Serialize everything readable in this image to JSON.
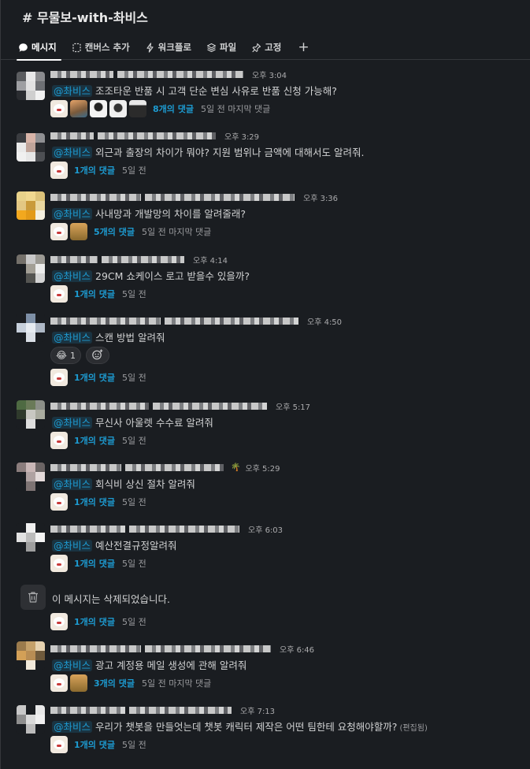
{
  "channel": {
    "title": "# 무물보-with-촤비스"
  },
  "tabs": [
    {
      "label": "메시지",
      "icon": "message-icon",
      "active": true
    },
    {
      "label": "캔버스 추가",
      "icon": "canvas-icon",
      "active": false
    },
    {
      "label": "워크플로",
      "icon": "workflow-icon",
      "active": false
    },
    {
      "label": "파일",
      "icon": "files-icon",
      "active": false
    },
    {
      "label": "고정",
      "icon": "pin-icon",
      "active": false
    }
  ],
  "add_tab_label": "+",
  "messages": [
    {
      "time": "오후 3:04",
      "mention": "@촤비스",
      "text": "조조타운 반품 시 고객 단순 변심 사유로 반품 신청 가능해?",
      "reply_count": "8개의 댓글",
      "reply_time": "5일 전 마지막 댓글"
    },
    {
      "time": "오후 3:29",
      "mention": "@촤비스",
      "text": "외근과 출장의 차이가 뭐야? 지원 범위나 금액에 대해서도 알려줘.",
      "reply_count": "1개의 댓글",
      "reply_time": "5일 전"
    },
    {
      "time": "오후 3:36",
      "mention": "@촤비스",
      "text": "사내망과 개발망의 차이를 알려줄래?",
      "reply_count": "5개의 댓글",
      "reply_time": "5일 전 마지막 댓글"
    },
    {
      "time": "오후 4:14",
      "mention": "@촤비스",
      "text": "29CM 쇼케이스 로고 받을수 있을까?",
      "reply_count": "1개의 댓글",
      "reply_time": "5일 전"
    },
    {
      "time": "오후 4:50",
      "mention": "@촤비스",
      "text": "스캔 방법 알려줘",
      "reaction_emoji": "😂",
      "reaction_count": "1",
      "reply_count": "1개의 댓글",
      "reply_time": "5일 전"
    },
    {
      "time": "오후 5:17",
      "mention": "@촤비스",
      "text": "무신사 아울렛 수수료 알려줘",
      "reply_count": "1개의 댓글",
      "reply_time": "5일 전"
    },
    {
      "time": "오후 5:29",
      "mention": "@촤비스",
      "text": "회식비 상신 절차 알려줘",
      "status_emoji": "🌴",
      "reply_count": "1개의 댓글",
      "reply_time": "5일 전"
    },
    {
      "time": "오후 6:03",
      "mention": "@촤비스",
      "text": "예산전결규정알려줘",
      "reply_count": "1개의 댓글",
      "reply_time": "5일 전"
    },
    {
      "deleted_text": "이 메시지는 삭제되었습니다.",
      "reply_count": "1개의 댓글",
      "reply_time": "5일 전"
    },
    {
      "time": "오후 6:46",
      "mention": "@촤비스",
      "text": "광고 계정용 메일 생성에 관해 알려줘",
      "reply_count": "3개의 댓글",
      "reply_time": "5일 전 마지막 댓글"
    },
    {
      "time": "오후 7:13",
      "mention": "@촤비스",
      "text": "우리가 챗봇을 만들엇는데 챗봇 캐릭터 제작은 어떤 팀한테 요청해야할까?",
      "edited": "(편집됨)",
      "reply_count": "1개의 댓글",
      "reply_time": "5일 전"
    }
  ],
  "colors": {
    "background": "#1a1d21",
    "mention": "#1d9bd1",
    "reply_link": "#1d9bd1",
    "text": "#d1d2d3"
  }
}
